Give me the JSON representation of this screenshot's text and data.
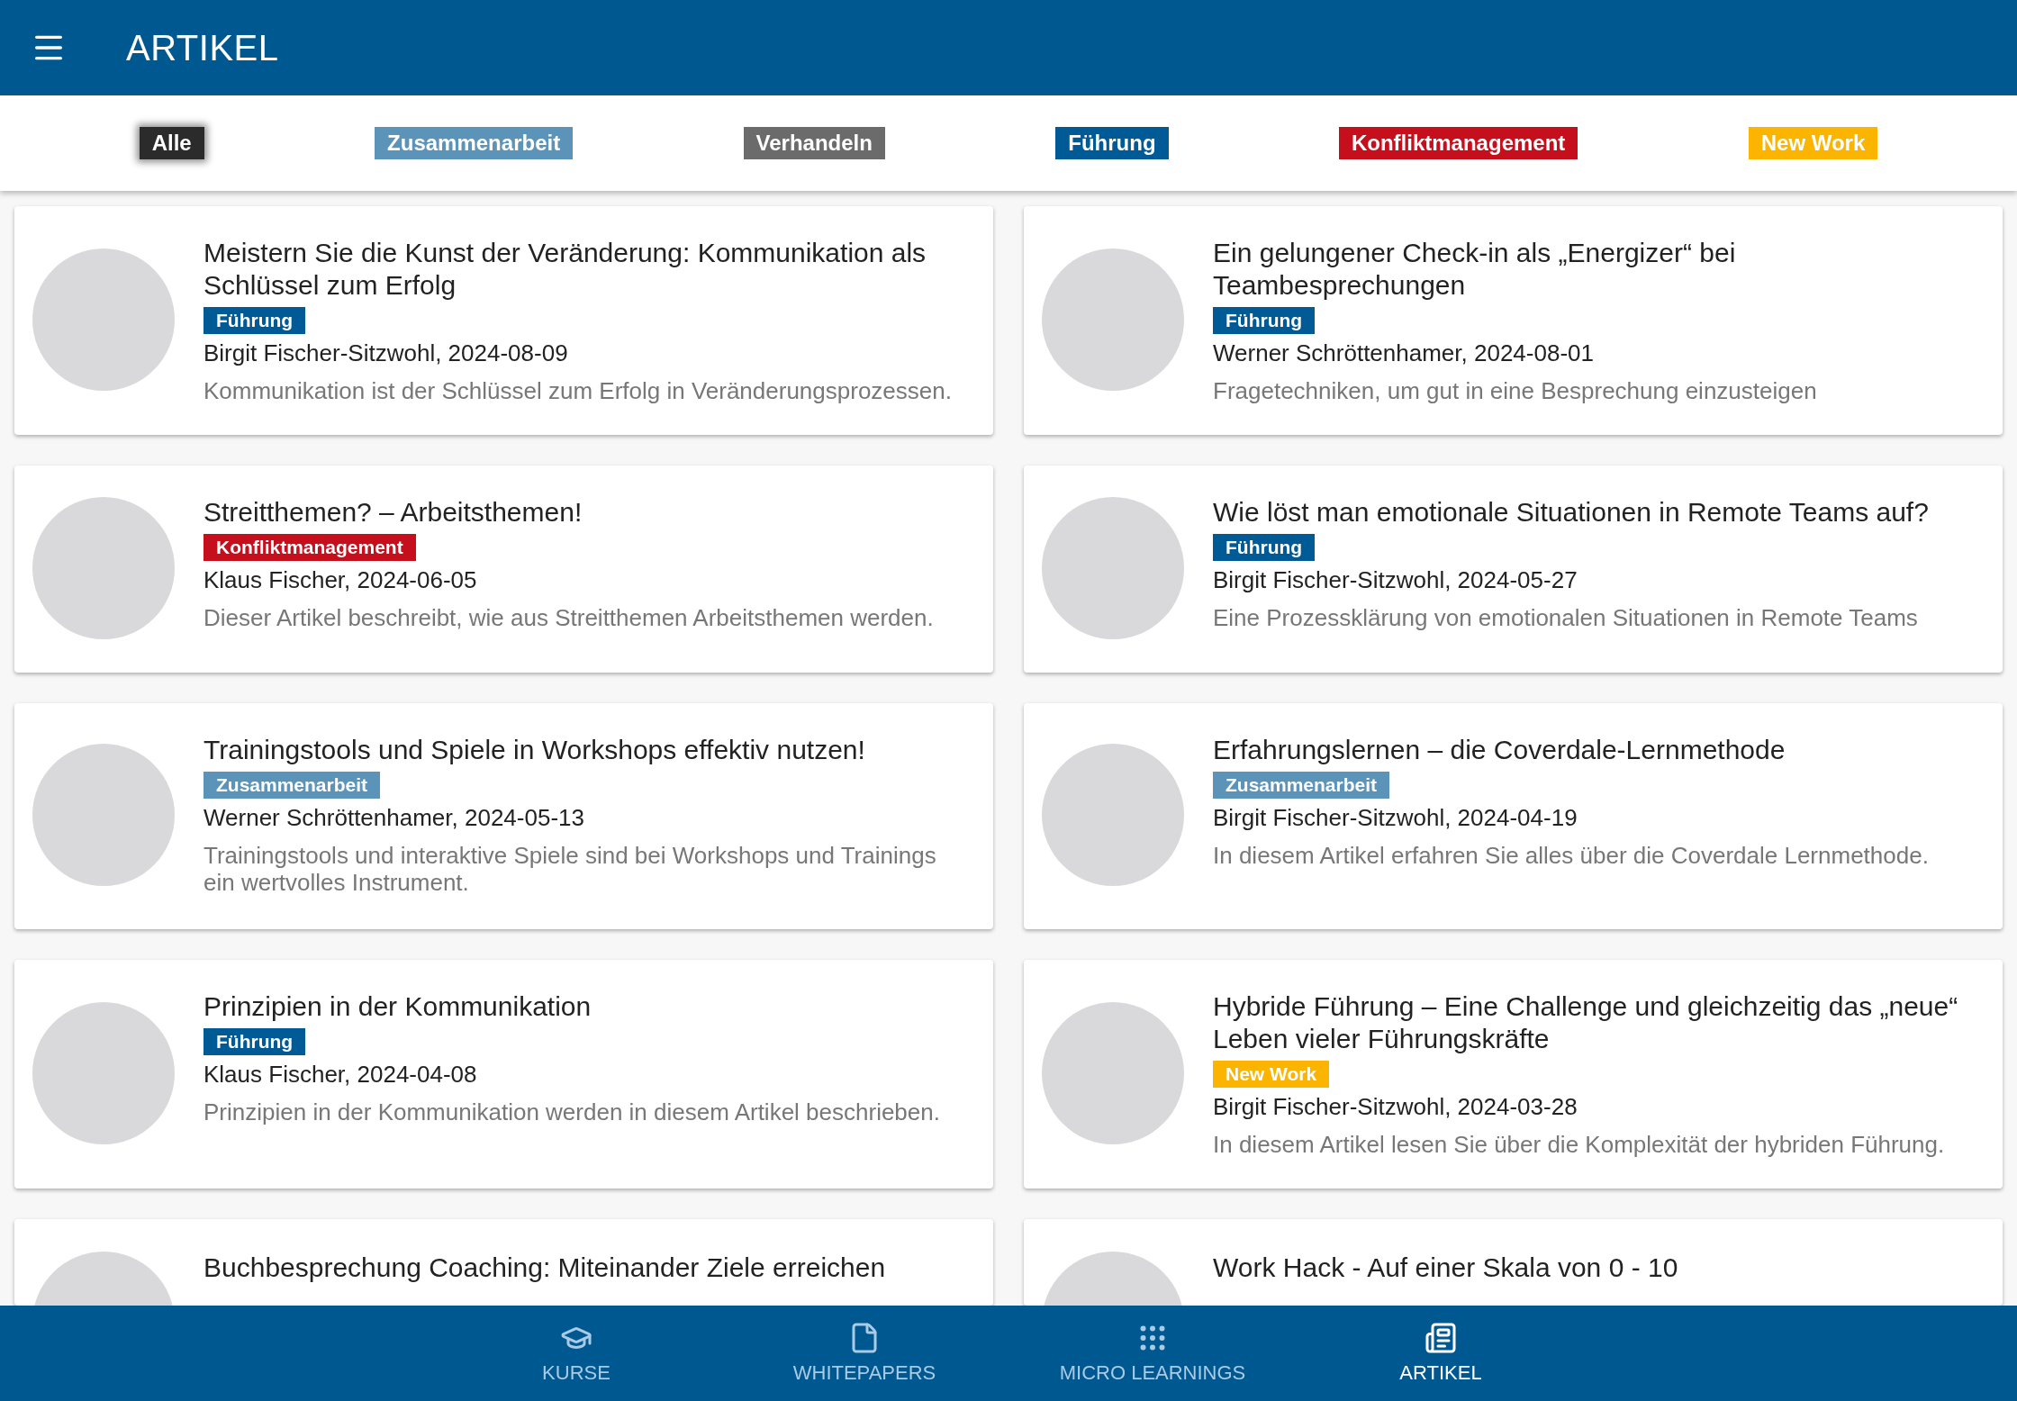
{
  "app_bar": {
    "title": "ARTIKEL"
  },
  "filters": [
    {
      "label": "Alle",
      "color": "#2b2b2b",
      "selected": true
    },
    {
      "label": "Zusammenarbeit",
      "color": "#5b93b9",
      "selected": false
    },
    {
      "label": "Verhandeln",
      "color": "#6b6b6b",
      "selected": false
    },
    {
      "label": "Führung",
      "color": "#005a96",
      "selected": false
    },
    {
      "label": "Konfliktmanagement",
      "color": "#c50f1c",
      "selected": false
    },
    {
      "label": "New Work",
      "color": "#fbb400",
      "selected": false
    }
  ],
  "articles": [
    {
      "title": "Meistern Sie die Kunst der Veränderung: Kommunikation als Schlüssel zum Erfolg",
      "tag": {
        "label": "Führung",
        "color": "#005a96"
      },
      "meta": "Birgit Fischer-Sitzwohl, 2024-08-09",
      "summary": "Kommunikation ist der Schlüssel zum Erfolg in Veränderungsprozessen."
    },
    {
      "title": "Ein gelungener Check-in als „Energizer“ bei Teambesprechungen",
      "tag": {
        "label": "Führung",
        "color": "#005a96"
      },
      "meta": "Werner Schröttenhamer, 2024-08-01",
      "summary": "Fragetechniken, um gut in eine Besprechung einzusteigen"
    },
    {
      "title": "Streitthemen? – Arbeitsthemen!",
      "tag": {
        "label": "Konfliktmanagement",
        "color": "#c50f1c"
      },
      "meta": "Klaus Fischer, 2024-06-05",
      "summary": "Dieser Artikel beschreibt, wie aus Streitthemen Arbeitsthemen werden."
    },
    {
      "title": "Wie löst man emotionale Situationen in Remote Teams auf?",
      "tag": {
        "label": "Führung",
        "color": "#005a96"
      },
      "meta": "Birgit Fischer-Sitzwohl, 2024-05-27",
      "summary": "Eine Prozessklärung von emotionalen Situationen in Remote Teams"
    },
    {
      "title": "Trainingstools und Spiele in Workshops effektiv nutzen!",
      "tag": {
        "label": "Zusammenarbeit",
        "color": "#5b93b9"
      },
      "meta": "Werner Schröttenhamer, 2024-05-13",
      "summary": "Trainingstools und interaktive Spiele sind bei Workshops und Trainings ein wertvolles Instrument."
    },
    {
      "title": "Erfahrungslernen – die Coverdale-Lernmethode",
      "tag": {
        "label": "Zusammenarbeit",
        "color": "#5b93b9"
      },
      "meta": "Birgit Fischer-Sitzwohl, 2024-04-19",
      "summary": "In diesem Artikel erfahren Sie alles über die Coverdale Lernmethode."
    },
    {
      "title": "Prinzipien in der Kommunikation",
      "tag": {
        "label": "Führung",
        "color": "#005a96"
      },
      "meta": "Klaus Fischer, 2024-04-08",
      "summary": "Prinzipien in der Kommunikation werden in diesem Artikel beschrieben."
    },
    {
      "title": "Hybride Führung – Eine Challenge und gleichzeitig das „neue“ Leben vieler Führungskräfte",
      "tag": {
        "label": "New Work",
        "color": "#fbb400"
      },
      "meta": "Birgit Fischer-Sitzwohl, 2024-03-28",
      "summary": "In diesem Artikel lesen Sie über die Komplexität der hybriden Führung."
    },
    {
      "title": "Buchbesprechung Coaching: Miteinander Ziele erreichen"
    },
    {
      "title": "Work Hack - Auf einer Skala von 0 - 10"
    }
  ],
  "bottom_nav": [
    {
      "label": "KURSE",
      "kind": "course",
      "selected": false
    },
    {
      "label": "WHITEPAPERS",
      "kind": "document",
      "selected": false
    },
    {
      "label": "MICRO LEARNINGS",
      "kind": "grid",
      "selected": false
    },
    {
      "label": "ARTIKEL",
      "kind": "article",
      "selected": true
    }
  ]
}
